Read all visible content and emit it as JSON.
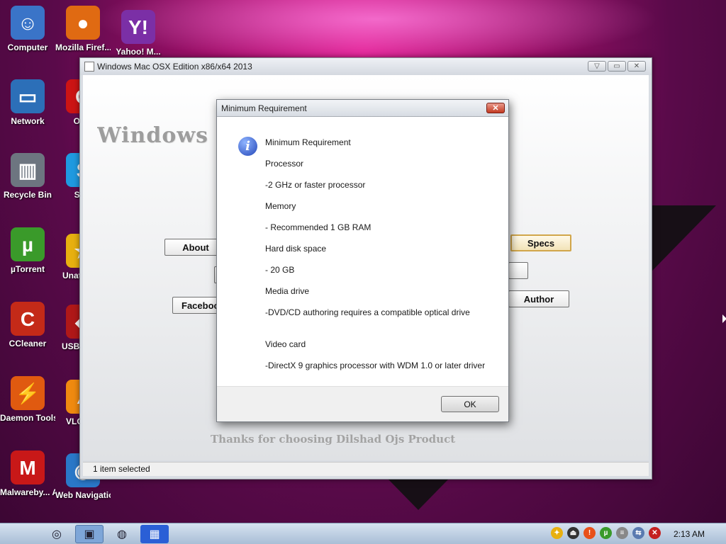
{
  "desktop": {
    "icons": [
      {
        "label": "Computer",
        "icon": "computer-icon",
        "glyph": "☺",
        "color": "#3a74c8"
      },
      {
        "label": "Mozilla Firef...",
        "icon": "firefox-icon",
        "glyph": "●",
        "color": "#e06a12"
      },
      {
        "label": "Yahoo! M...",
        "icon": "yahoo-messenger-icon",
        "glyph": "Y!",
        "color": "#7b2fa6"
      },
      {
        "label": "Network",
        "icon": "network-icon",
        "glyph": "▭",
        "color": "#2c6fb8"
      },
      {
        "label": "Op...",
        "icon": "opera-icon",
        "glyph": "O",
        "color": "#cc1414"
      },
      {
        "label": "Recycle Bin",
        "icon": "recycle-bin-icon",
        "glyph": "▥",
        "color": "#6d7580"
      },
      {
        "label": "Sk...",
        "icon": "skype-icon",
        "glyph": "S",
        "color": "#1f9ae0"
      },
      {
        "label": "µTorrent",
        "icon": "utorrent-icon",
        "glyph": "µ",
        "color": "#3a9a2a"
      },
      {
        "label": "Unat... S...",
        "icon": "unattended-star-icon",
        "glyph": "★",
        "color": "#e8b010"
      },
      {
        "label": "CCleaner",
        "icon": "ccleaner-icon",
        "glyph": "C",
        "color": "#c42a18"
      },
      {
        "label": "USB Sec...",
        "icon": "usb-security-icon",
        "glyph": "◆",
        "color": "#b01818"
      },
      {
        "label": "Daemon Tools PRO",
        "icon": "daemon-tools-icon",
        "glyph": "⚡",
        "color": "#e05a10"
      },
      {
        "label": "VLC pl...",
        "icon": "vlc-icon",
        "glyph": "▲",
        "color": "#f08a10"
      },
      {
        "label": "Malwareby... Anti-Malwa...",
        "icon": "malwarebytes-icon",
        "glyph": "M",
        "color": "#c81818"
      },
      {
        "label": "Web Navigation",
        "icon": "web-navigation-icon",
        "glyph": "◉",
        "color": "#2a78c8"
      }
    ]
  },
  "main_window": {
    "title": "Windows Mac OSX Edition x86/x64 2013",
    "heading": "Windows Mac OSX Edition 2013",
    "thanks_text": "Thanks for choosing Dilshad Ojs Product",
    "buttons": {
      "about": "About",
      "facebook": "Facebook",
      "specs": "Specs",
      "author": "Author"
    },
    "status": "1 item selected"
  },
  "dialog": {
    "title": "Minimum Requirement",
    "lines": [
      "Minimum Requirement",
      "Processor",
      "-2 GHz or faster processor",
      "Memory",
      "- Recommended 1 GB RAM",
      "Hard disk space",
      "- 20 GB",
      "Media drive",
      "-DVD/CD authoring requires a compatible optical drive",
      "",
      "Video card",
      "-DirectX 9 graphics processor with WDM 1.0 or later driver"
    ],
    "ok_label": "OK"
  },
  "taskbar": {
    "clock": "2:13 AM"
  }
}
